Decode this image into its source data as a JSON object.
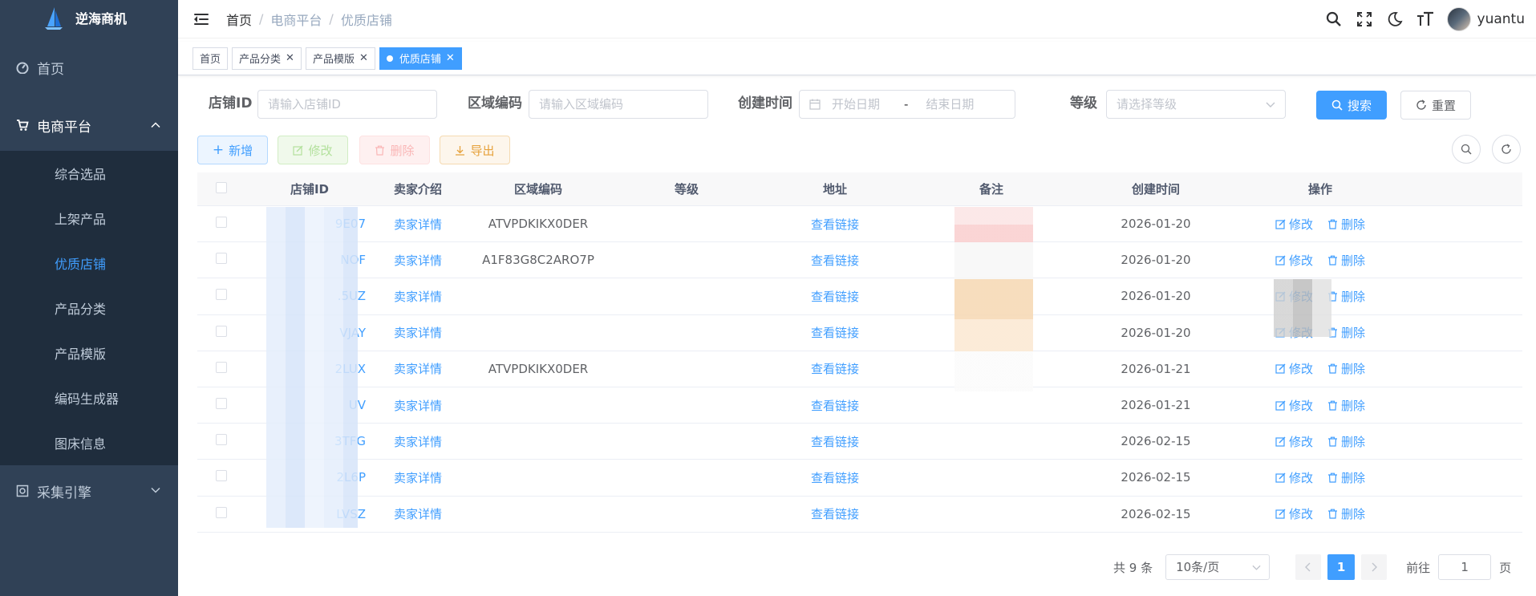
{
  "app": {
    "title": "逆海商机"
  },
  "sidebar": {
    "items": [
      {
        "label": "首页"
      },
      {
        "label": "电商平台",
        "children": [
          "综合选品",
          "上架产品",
          "优质店铺",
          "产品分类",
          "产品模版",
          "编码生成器",
          "图床信息"
        ],
        "active_child": "优质店铺"
      },
      {
        "label": "采集引擎"
      }
    ]
  },
  "breadcrumb": [
    "首页",
    "电商平台",
    "优质店铺"
  ],
  "user": {
    "name": "yuantu"
  },
  "tabs": [
    {
      "label": "首页",
      "closable": false,
      "active": false
    },
    {
      "label": "产品分类",
      "closable": true,
      "active": false
    },
    {
      "label": "产品模版",
      "closable": true,
      "active": false
    },
    {
      "label": "优质店铺",
      "closable": true,
      "active": true
    }
  ],
  "search": {
    "shop_id_label": "店铺ID",
    "shop_id_placeholder": "请输入店铺ID",
    "region_label": "区域编码",
    "region_placeholder": "请输入区域编码",
    "created_label": "创建时间",
    "start_placeholder": "开始日期",
    "range_sep": "-",
    "end_placeholder": "结束日期",
    "level_label": "等级",
    "level_placeholder": "请选择等级",
    "search_button": "搜索",
    "reset_button": "重置"
  },
  "toolbar": {
    "add": "新增",
    "edit": "修改",
    "delete": "删除",
    "export": "导出"
  },
  "table": {
    "columns": [
      "店铺ID",
      "卖家介绍",
      "区域编码",
      "等级",
      "地址",
      "备注",
      "创建时间",
      "操作"
    ],
    "rows": [
      {
        "shop_id": "9E07",
        "seller": "卖家详情",
        "region": "ATVPDKIKX0DER",
        "address": "查看链接",
        "created": "2026-01-20"
      },
      {
        "shop_id": "NOF",
        "seller": "卖家详情",
        "region": "A1F83G8C2ARO7P",
        "address": "查看链接",
        "created": "2026-01-20"
      },
      {
        "shop_id": ".5UZ",
        "seller": "卖家详情",
        "region": "",
        "address": "查看链接",
        "created": "2026-01-20"
      },
      {
        "shop_id": "VJAY",
        "seller": "卖家详情",
        "region": "",
        "address": "查看链接",
        "created": "2026-01-20"
      },
      {
        "shop_id": "2LUX",
        "seller": "卖家详情",
        "region": "ATVPDKIKX0DER",
        "address": "查看链接",
        "created": "2026-01-21"
      },
      {
        "shop_id": "UV",
        "seller": "卖家详情",
        "region": "",
        "address": "查看链接",
        "created": "2026-01-21"
      },
      {
        "shop_id": "3TFG",
        "seller": "卖家详情",
        "region": "",
        "address": "查看链接",
        "created": "2026-02-15"
      },
      {
        "shop_id": "2L6P",
        "seller": "卖家详情",
        "region": "",
        "address": "查看链接",
        "created": "2026-02-15"
      },
      {
        "shop_id": "LVSZ",
        "seller": "卖家详情",
        "region": "",
        "address": "查看链接",
        "created": "2026-02-15"
      }
    ],
    "row_actions": {
      "edit": "修改",
      "delete": "删除"
    }
  },
  "pagination": {
    "total": "共 9 条",
    "page_size": "10条/页",
    "current_page": "1",
    "goto_label": "前往",
    "goto_value": "1",
    "page_suffix": "页"
  },
  "colors": {
    "accent": "#409eff",
    "sidebar_bg": "#304156",
    "submenu_bg": "#1f2d3d"
  }
}
